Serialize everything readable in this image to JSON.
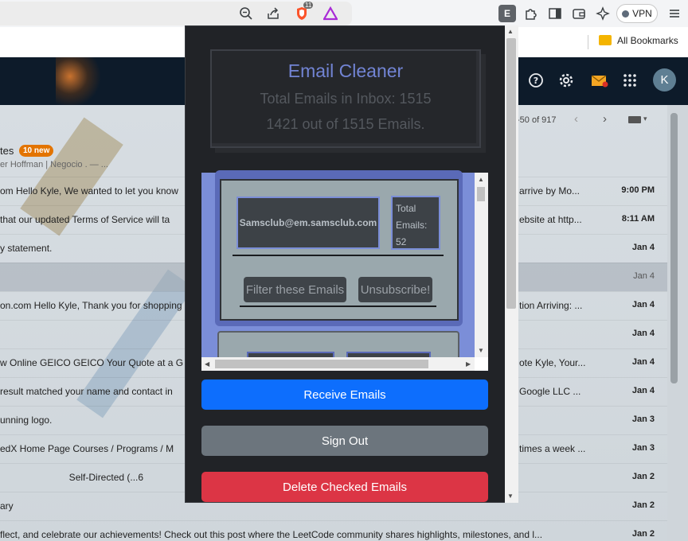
{
  "browser": {
    "extensions_badge_count": "11",
    "vpn_label": "VPN",
    "extension_icon_letter": "E",
    "bookmarks_label": "All Bookmarks"
  },
  "gmail": {
    "avatar_letter": "K",
    "promotions_title": "tes",
    "promotions_new": "10 new",
    "promotions_sub": "er Hoffman | Negocio . — ...",
    "pager": "-50 of 917",
    "rows": [
      {
        "left": "om Hello Kyle, We wanted to let you know",
        "right": "arrive by Mo...",
        "date": "9:00 PM"
      },
      {
        "left": "that our updated Terms of Service will ta",
        "right": "ebsite at http...",
        "date": "8:11 AM"
      },
      {
        "left": "y statement.",
        "right": "",
        "date": "Jan 4"
      },
      {
        "left": "",
        "right": "",
        "date": "Jan 4"
      },
      {
        "left": "on.com Hello Kyle, Thank you for shopping",
        "right": "tion Arriving: ...",
        "date": "Jan 4"
      },
      {
        "left": "",
        "right": "",
        "date": "Jan 4"
      },
      {
        "left": "w Online GEICO GEICO Your Quote at a G",
        "right": "ote Kyle, Your...",
        "date": "Jan 4"
      },
      {
        "left": "result matched your name and contact in",
        "right": "Google LLC ...",
        "date": "Jan 4"
      },
      {
        "left": "unning logo.",
        "right": "",
        "date": "Jan 3"
      },
      {
        "left": "edX Home Page Courses / Programs / M",
        "right": "times a week ...",
        "date": "Jan 3"
      },
      {
        "left": "                          Self-Directed (...6",
        "right": "",
        "date": "Jan 2"
      },
      {
        "left": "ary",
        "right": "",
        "date": "Jan 2"
      },
      {
        "left": "flect, and celebrate our achievements! Check out this post where the LeetCode community shares highlights, milestones, and l...",
        "right": "",
        "date": "Jan 2"
      }
    ]
  },
  "popup": {
    "title": "Email Cleaner",
    "total_line": "Total Emails in Inbox: 1515",
    "progress_line": "1421 out of 1515 Emails.",
    "sender": "Samsclub@em.samsclub.com",
    "total_label": "Total Emails:",
    "total_count": "52",
    "filter_label": "Filter these Emails",
    "unsubscribe_label": "Unsubscribe!",
    "receive_label": "Receive Emails",
    "signout_label": "Sign Out",
    "delete_label": "Delete Checked Emails",
    "colors": {
      "primary": "#0d6efd",
      "secondary": "#6c757d",
      "danger": "#dc3545",
      "accent": "#7284d4"
    }
  }
}
